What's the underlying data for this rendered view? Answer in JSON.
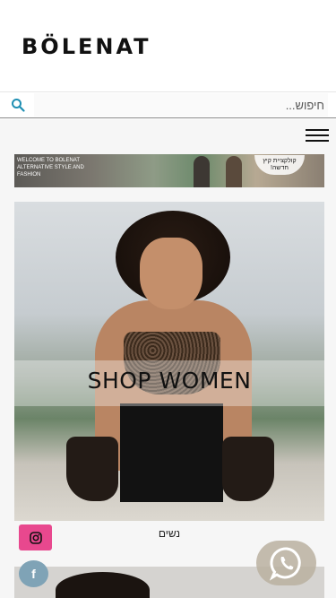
{
  "header": {
    "logo_text": "BÖLENAT"
  },
  "search": {
    "placeholder": "חיפוש..."
  },
  "menu": {
    "icon": "hamburger-icon"
  },
  "promo_banner": {
    "left_text": "WELCOME TO BOLENAT ALTERNATIVE STYLE AND FASHION",
    "right_text": "קולקציית קיץ חדשה!"
  },
  "hero": {
    "title": "SHOP WOMEN",
    "caption": "נשים"
  },
  "social": {
    "instagram_icon": "instagram-icon",
    "facebook_icon": "facebook-icon",
    "facebook_glyph": "f",
    "instagram_color": "#e8488e",
    "facebook_color": "#7fa3b6"
  },
  "whatsapp": {
    "icon": "whatsapp-icon",
    "color": "#bab0a0"
  }
}
